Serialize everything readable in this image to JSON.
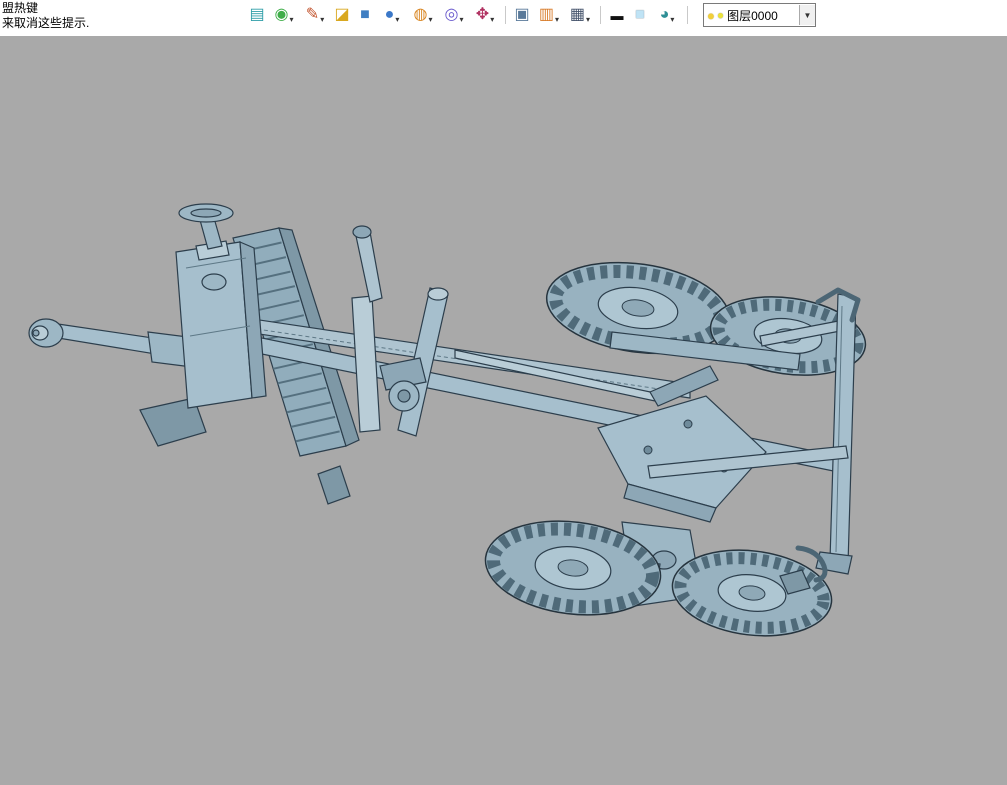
{
  "hint": {
    "line1": "盟热键",
    "line2": "来取消这些提示."
  },
  "toolbar": {
    "dropdown_arrow": "▾",
    "icons": [
      {
        "name": "import-icon",
        "glyph": "▤",
        "dropdown": false
      },
      {
        "name": "material-icon",
        "glyph": "◉",
        "dropdown": true
      },
      {
        "name": "pencil-edit-icon",
        "glyph": "✎",
        "dropdown": true
      },
      {
        "name": "surface-icon",
        "glyph": "◪",
        "dropdown": false
      },
      {
        "name": "solid-cube-icon",
        "glyph": "■",
        "dropdown": false
      },
      {
        "name": "sphere-icon",
        "glyph": "●",
        "dropdown": true
      },
      {
        "name": "wireframe-sphere-icon",
        "glyph": "◍",
        "dropdown": true
      },
      {
        "name": "zoom-icon",
        "glyph": "◎",
        "dropdown": true
      },
      {
        "name": "pan-move-icon",
        "glyph": "✥",
        "dropdown": true
      },
      {
        "name": "viewport-window-icon",
        "glyph": "▣",
        "dropdown": false
      },
      {
        "name": "grid-ruler-icon",
        "glyph": "▥",
        "dropdown": true
      },
      {
        "name": "display-monitor-icon",
        "glyph": "▦",
        "dropdown": true
      },
      {
        "name": "line-width-icon",
        "glyph": "▬",
        "dropdown": false
      },
      {
        "name": "color-swatch-icon",
        "glyph": "■",
        "dropdown": false
      },
      {
        "name": "visibility-lens-icon",
        "glyph": "◕",
        "dropdown": true
      }
    ]
  },
  "layer": {
    "bulb_glyph": "●",
    "color_glyph": "●",
    "current": "图层0000",
    "arrow": "▼"
  },
  "colors": {
    "toolbar_bg": "#ffffff",
    "canvas_bg": "#a9a9a9",
    "model_fill": "#a6bfcd",
    "model_shade": "#8da7b6",
    "model_dark": "#7e98a6",
    "model_outline": "#2c3e4c"
  }
}
